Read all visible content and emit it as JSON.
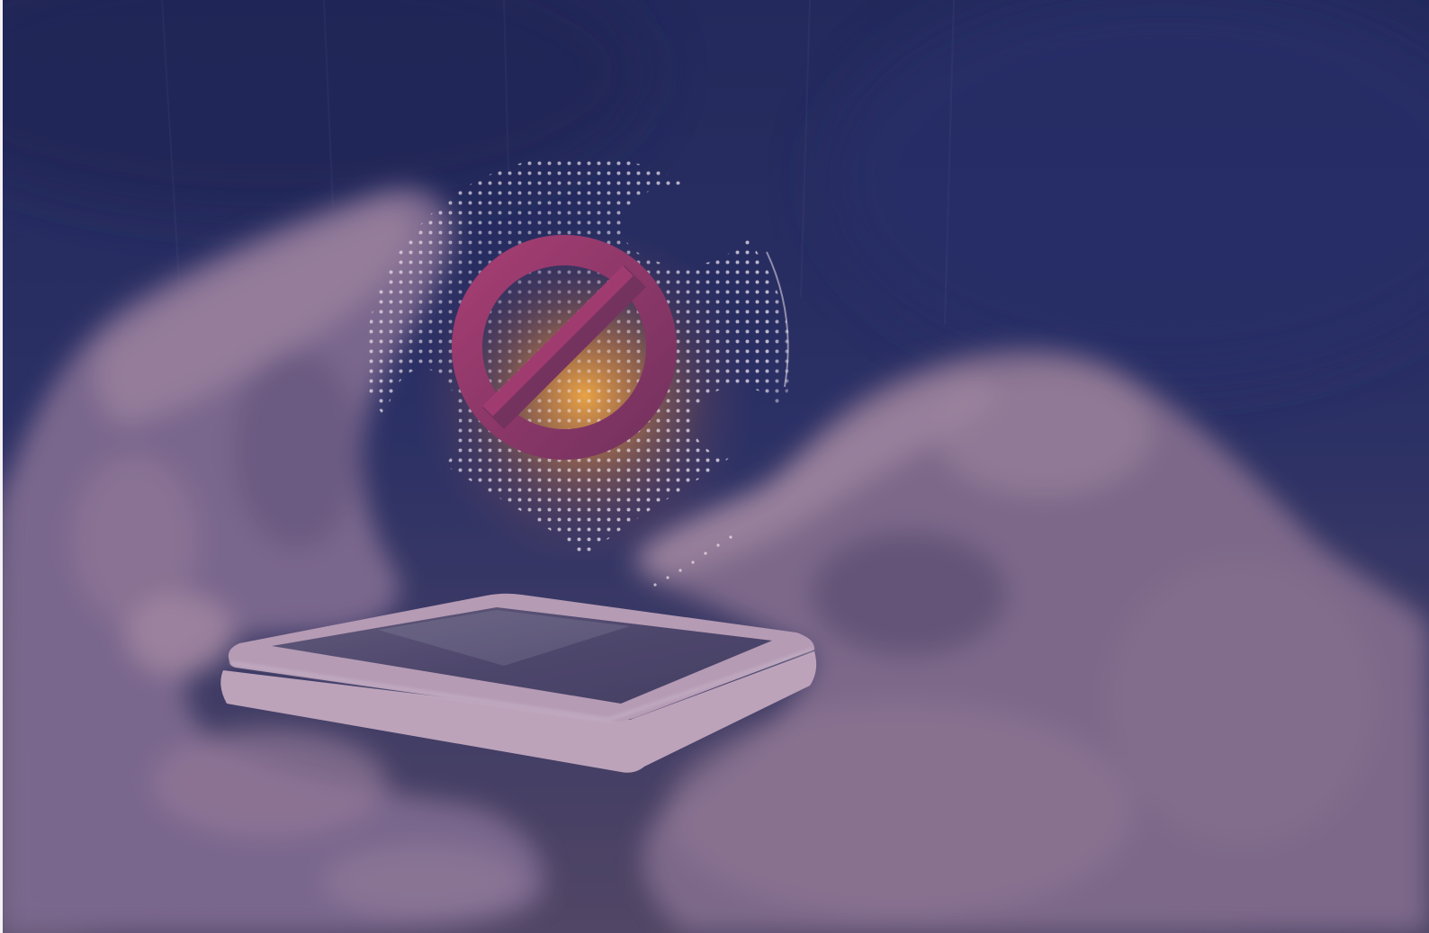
{
  "colors": {
    "background_top": "#222858",
    "background_mid": "#2b3063",
    "background_bottom": "#5a4b63",
    "skin_base": "#8c7394",
    "skin_highlight": "#b596aa",
    "phone_body": "#d4b2c4",
    "phone_side": "#dcbccb",
    "phone_screen": "#564c6c",
    "glow": "#f2a944",
    "globe_dots": "#ece3ee",
    "prohibition_light": "#a53d72",
    "prohibition_dark": "#74325f"
  },
  "icons": {
    "overlay": "prohibition-icon",
    "pin": "globe-map-pin-icon"
  }
}
